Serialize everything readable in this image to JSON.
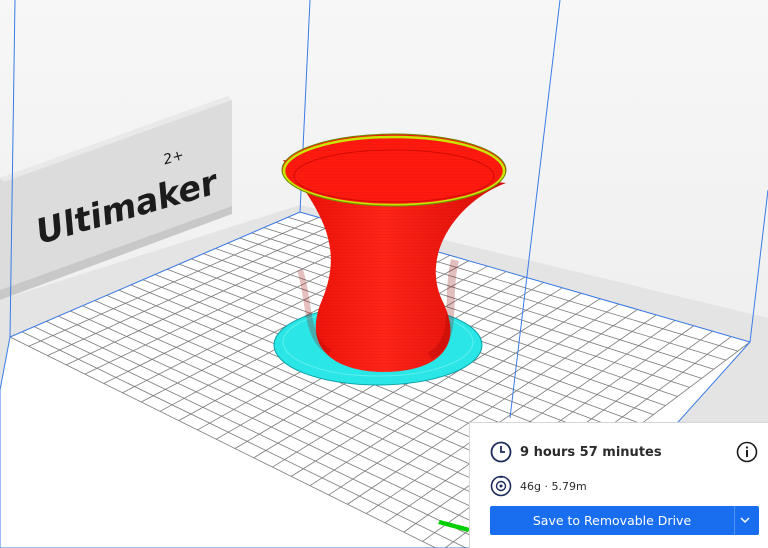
{
  "scene": {
    "backplate_brand": "Ultimaker",
    "backplate_model": "2+"
  },
  "print_info": {
    "time_icon": "clock-icon",
    "print_time": "9 hours 57 minutes",
    "material_icon": "spool-icon",
    "material_usage": "46g · 5.79m",
    "info_icon": "info-icon",
    "save_button": "Save to Removable Drive",
    "dropdown_icon": "chevron-down-icon"
  },
  "colors": {
    "model": "#ff1a0f",
    "skirt": "#2be6e6",
    "top_edge": "#c8e600",
    "button": "#196ef0"
  }
}
